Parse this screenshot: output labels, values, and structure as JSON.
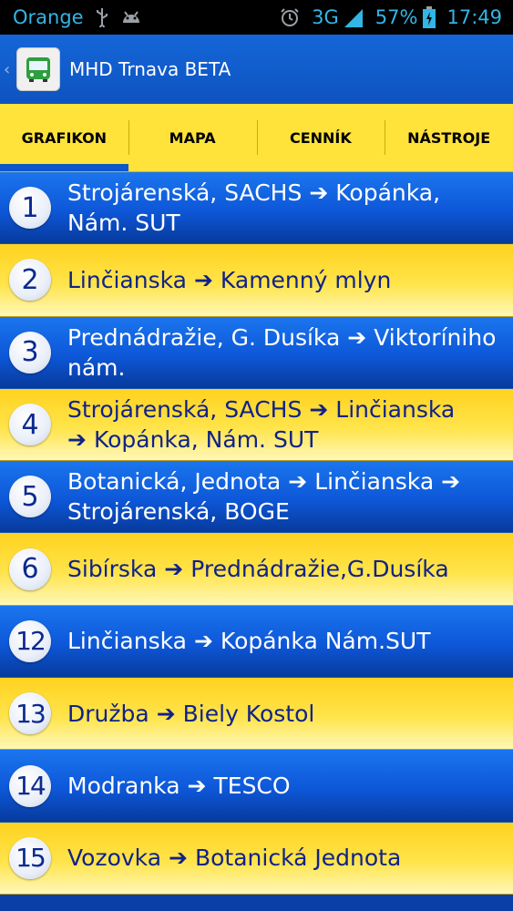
{
  "status": {
    "carrier": "Orange",
    "network": "3G",
    "battery": "57%",
    "time": "17:49"
  },
  "app": {
    "title": "MHD Trnava BETA"
  },
  "tabs": [
    {
      "label": "GRAFIKON",
      "active": true
    },
    {
      "label": "MAPA",
      "active": false
    },
    {
      "label": "CENNÍK",
      "active": false
    },
    {
      "label": "NÁSTROJE",
      "active": false
    }
  ],
  "routes": [
    {
      "number": "1",
      "stops": [
        "Strojárenská, SACHS",
        "Kopánka, Nám. SUT"
      ]
    },
    {
      "number": "2",
      "stops": [
        "Linčianska",
        "Kamenný mlyn"
      ]
    },
    {
      "number": "3",
      "stops": [
        "Prednádražie, G. Dusíka",
        "Viktoríniho nám."
      ]
    },
    {
      "number": "4",
      "stops": [
        "Strojárenská, SACHS",
        "Linčianska",
        "Kopánka, Nám. SUT"
      ]
    },
    {
      "number": "5",
      "stops": [
        "Botanická, Jednota",
        "Linčianska",
        "Strojárenská, BOGE"
      ]
    },
    {
      "number": "6",
      "stops": [
        "Sibírska",
        "Prednádražie,G.Dusíka"
      ]
    },
    {
      "number": "12",
      "stops": [
        "Linčianska",
        "Kopánka Nám.SUT"
      ]
    },
    {
      "number": "13",
      "stops": [
        "Družba",
        "Biely Kostol"
      ]
    },
    {
      "number": "14",
      "stops": [
        "Modranka",
        "TESCO"
      ]
    },
    {
      "number": "15",
      "stops": [
        "Vozovka",
        "Botanická Jednota"
      ]
    }
  ],
  "colors": {
    "blue": "#0d57d8",
    "yellow": "#ffe23a",
    "dark_blue_text": "#10228a"
  }
}
